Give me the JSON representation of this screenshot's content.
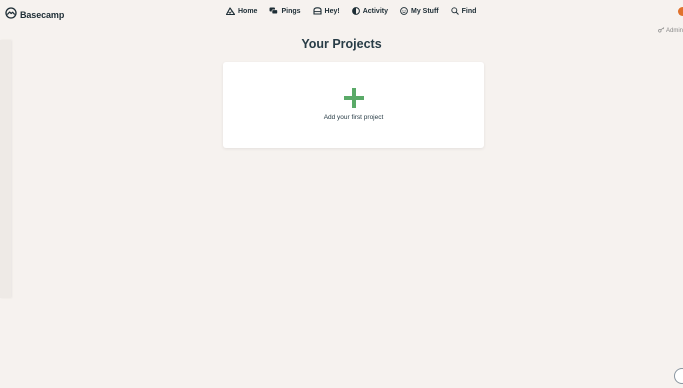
{
  "brand": {
    "name": "Basecamp",
    "icon": "basecamp-logo-icon"
  },
  "nav": [
    {
      "label": "Home",
      "icon": "home-mountain-icon"
    },
    {
      "label": "Pings",
      "icon": "pings-chat-icon"
    },
    {
      "label": "Hey!",
      "icon": "hey-inbox-icon"
    },
    {
      "label": "Activity",
      "icon": "activity-icon"
    },
    {
      "label": "My Stuff",
      "icon": "my-stuff-icon"
    },
    {
      "label": "Find",
      "icon": "search-icon"
    }
  ],
  "admin": {
    "label": "Admin",
    "icon": "key-icon"
  },
  "main": {
    "title": "Your Projects",
    "new_project": {
      "label": "Add your first project",
      "icon": "plus-icon"
    }
  },
  "colors": {
    "background": "#f6f2ef",
    "accent_green": "#5aaa68",
    "text": "#283c46"
  }
}
